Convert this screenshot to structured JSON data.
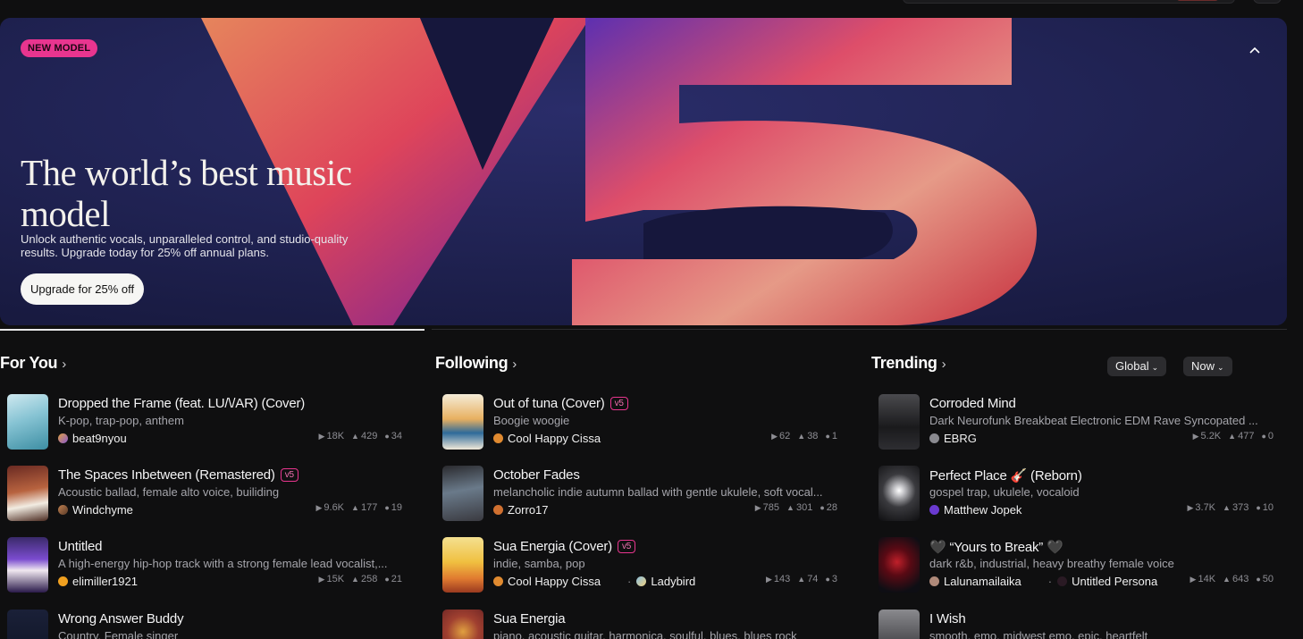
{
  "banner": {
    "badge": "NEW MODEL",
    "headline": "The world’s best music model",
    "subtext": "Unlock authentic vocals, unparalleled control, and studio-quality results. Upgrade today for 25% off annual plans.",
    "cta": "Upgrade for 25% off",
    "art_text": "V5"
  },
  "sections": [
    {
      "title": "For You",
      "songs": [
        {
          "title": "Dropped the Frame (feat. LU/\\/AR) (Cover)",
          "desc": "K-pop, trap-pop, anthem",
          "artist": "beat9nyou",
          "plays": "18K",
          "likes": "429",
          "comments": "34"
        },
        {
          "title": "The Spaces Inbetween (Remastered)",
          "v5": "v5",
          "desc": "Acoustic ballad, female alto voice, builiding",
          "artist": "Windchyme",
          "plays": "9.6K",
          "likes": "177",
          "comments": "19"
        },
        {
          "title": "Untitled",
          "desc": "A high-energy hip-hop track with a strong female lead vocalist,...",
          "artist": "elimiller1921",
          "plays": "15K",
          "likes": "258",
          "comments": "21"
        },
        {
          "title": "Wrong Answer Buddy",
          "desc": "Country, Female singer"
        }
      ]
    },
    {
      "title": "Following",
      "songs": [
        {
          "title": "Out of tuna (Cover)",
          "v5": "v5",
          "desc": "Boogie woogie",
          "artist": "Cool Happy Cissa",
          "plays": "62",
          "likes": "38",
          "comments": "1"
        },
        {
          "title": "October Fades",
          "desc": "melancholic indie autumn ballad with gentle ukulele, soft vocal...",
          "artist": "Zorro17",
          "plays": "785",
          "likes": "301",
          "comments": "28"
        },
        {
          "title": "Sua Energia (Cover)",
          "v5": "v5",
          "desc": "indie, samba, pop",
          "artist": "Cool Happy Cissa",
          "artist2": "Ladybird",
          "plays": "143",
          "likes": "74",
          "comments": "3"
        },
        {
          "title": "Sua Energia",
          "desc": "piano, acoustic guitar, harmonica, soulful, blues, blues rock"
        }
      ]
    },
    {
      "title": "Trending",
      "filters": [
        "Global",
        "Now"
      ],
      "songs": [
        {
          "title": "Corroded Mind",
          "desc": "Dark Neurofunk Breakbeat Electronic EDM Rave Syncopated ...",
          "artist": "EBRG",
          "plays": "5.2K",
          "likes": "477",
          "comments": "0"
        },
        {
          "title": "Perfect Place 🎸 (Reborn)",
          "desc": "gospel trap, ukulele, vocaloid",
          "artist": "Matthew Jopek",
          "plays": "3.7K",
          "likes": "373",
          "comments": "10"
        },
        {
          "title": "🖤 “Yours to Break” 🖤",
          "desc": "dark r&b, industrial, heavy breathy female voice",
          "artist": "Lalunamailaika",
          "artist2": "Untitled Persona",
          "plays": "14K",
          "likes": "643",
          "comments": "50"
        },
        {
          "title": "I Wish",
          "desc": "smooth, emo, midwest emo, epic, heartfelt"
        }
      ]
    }
  ],
  "colors": {
    "accent": "#e8358f",
    "background": "#0f0f10",
    "banner_blue": "#1a1c47"
  }
}
